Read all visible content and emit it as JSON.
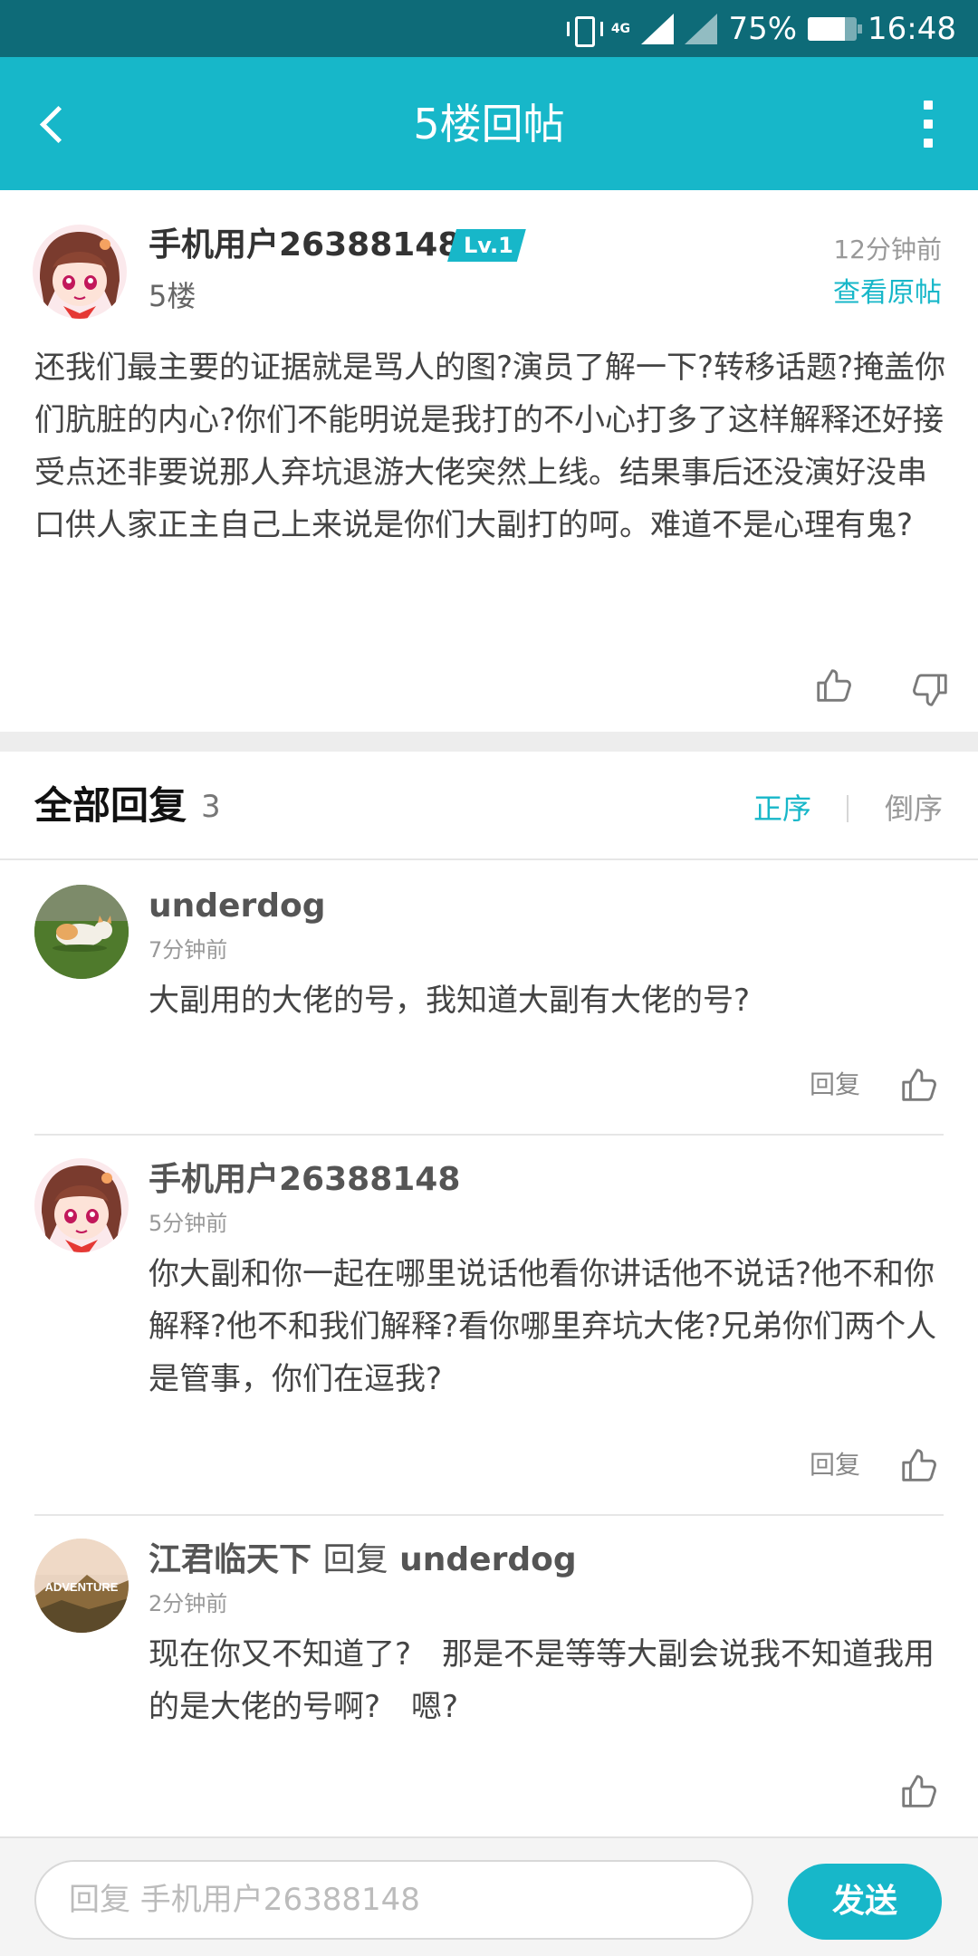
{
  "status_bar": {
    "network": "4G",
    "battery_text": "75%",
    "battery_level": 0.75,
    "time": "16:48"
  },
  "header": {
    "title": "5楼回帖",
    "back_icon": "chevron-left-icon",
    "more_icon": "more-vertical-icon"
  },
  "post": {
    "username": "手机用户26388148",
    "level": "Lv.1",
    "floor": "5楼",
    "time": "12分钟前",
    "view_original": "查看原帖",
    "body": "还我们最主要的证据就是骂人的图?演员了解一下?转移话题?掩盖你们肮脏的内心?你们不能明说是我打的不小心打多了这样解释还好接受点还非要说那人弃坑退游大佬突然上线。结果事后还没演好没串口供人家正主自己上来说是你们大副打的呵。难道不是心理有鬼?"
  },
  "replies_header": {
    "title": "全部回复",
    "count": "3",
    "sort_asc": "正序",
    "sort_desc": "倒序",
    "active_color": "#17b7c9"
  },
  "replies": [
    {
      "username": "underdog",
      "time": "7分钟前",
      "body": "大副用的大佬的号，我知道大副有大佬的号?",
      "reply_label": "回复"
    },
    {
      "username": "手机用户26388148",
      "time": "5分钟前",
      "body": "你大副和你一起在哪里说话他看你讲话他不说话?他不和你解释?他不和我们解释?看你哪里弃坑大佬?兄弟你们两个人是管事，你们在逗我?",
      "reply_label": "回复"
    },
    {
      "username": "江君临天下",
      "reply_word": "回复",
      "reply_target": "underdog",
      "avatar_text": "ADVENTURE",
      "time": "2分钟前",
      "body": "现在你又不知道了?　那是不是等等大副会说我不知道我用的是大佬的号啊?　嗯?"
    }
  ],
  "bottom_bar": {
    "input_placeholder": "回复 手机用户26388148",
    "send_label": "发送"
  },
  "colors": {
    "status_bar": "#0e6b78",
    "title_bar": "#17b7c9",
    "accent": "#17b7c9"
  }
}
